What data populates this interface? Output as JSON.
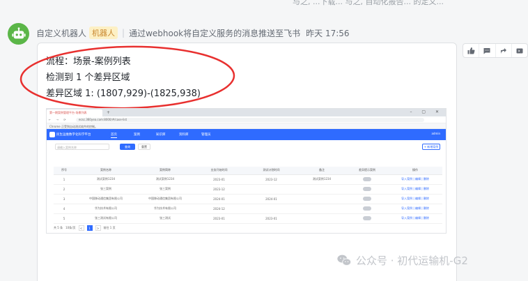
{
  "top_fragment": "与之, ...下载... 与之, 自动化报告... 的定义...",
  "message": {
    "sender": "自定义机器人",
    "bot_tag": "机器人",
    "separator": "|",
    "description": "通过webhook将自定义服务的消息推送至飞书",
    "time": "昨天 17:56"
  },
  "card": {
    "line1": "流程：场景-案例列表",
    "line2": "检测到 1 个差异区域",
    "line3": "差异区域 1: (1807,929)-(1825,938)",
    "highlight_color": "#e8302f"
  },
  "actions": [
    "thumbs-up-icon",
    "comment-icon",
    "share-icon",
    "forward-icon"
  ],
  "screenshot": {
    "tab_title": "第一期案例管理平台-场景列表",
    "tab_plus": "+",
    "window_controls": "– ▢ ✕",
    "nav": "← → ⟳",
    "url": "ecsc.360yea.com:8000/#/case-list",
    "notice": "Chrome 正受到自动测试软件的控制。",
    "brand": "民生运维数字化科学平台",
    "menu": [
      "首页",
      "案例",
      "知识库",
      "资料库",
      "管理员"
    ],
    "user": "admin",
    "search_placeholder": "请输入案例名称",
    "search_btn": "查询",
    "reset_btn": "重置",
    "add_btn": "+ 新增案例",
    "columns": [
      "序号",
      "案例名称",
      "案例简称",
      "业务开始时间",
      "测试计划时间",
      "备注",
      "差异提示案例",
      "操作"
    ],
    "rows": [
      [
        "1",
        "测试案例1234",
        "测试案例1234",
        "2023-01",
        "2023-12",
        "测试案例1234",
        "",
        "导入案例 | 编辑 | 删除"
      ],
      [
        "2",
        "张三案例",
        "张三案例",
        "2023-12",
        "",
        "",
        "",
        "导入案例 | 编辑 | 删除"
      ],
      [
        "3",
        "中国移动通信集团有限公司",
        "中国移动通信集团有限公司",
        "2024-01",
        "2024-01",
        "",
        "",
        "导入案例 | 编辑 | 删除"
      ],
      [
        "4",
        "华为技术有限公司",
        "华为技术有限公司",
        "2024-12",
        "",
        "",
        "",
        "导入案例 | 编辑 | 删除"
      ],
      [
        "5",
        "张三测试有限公司",
        "张三测试",
        "2023-01",
        "2023-01",
        "",
        "",
        "导入案例 | 编辑 | 删除"
      ]
    ],
    "pager_total": "共 5 条",
    "pager_size": "10条/页",
    "pager_prev": "<",
    "pager_current": "1",
    "pager_next": ">",
    "pager_goto": "前往 1 页"
  },
  "watermark": "公众号 · 初代运输机-G2"
}
